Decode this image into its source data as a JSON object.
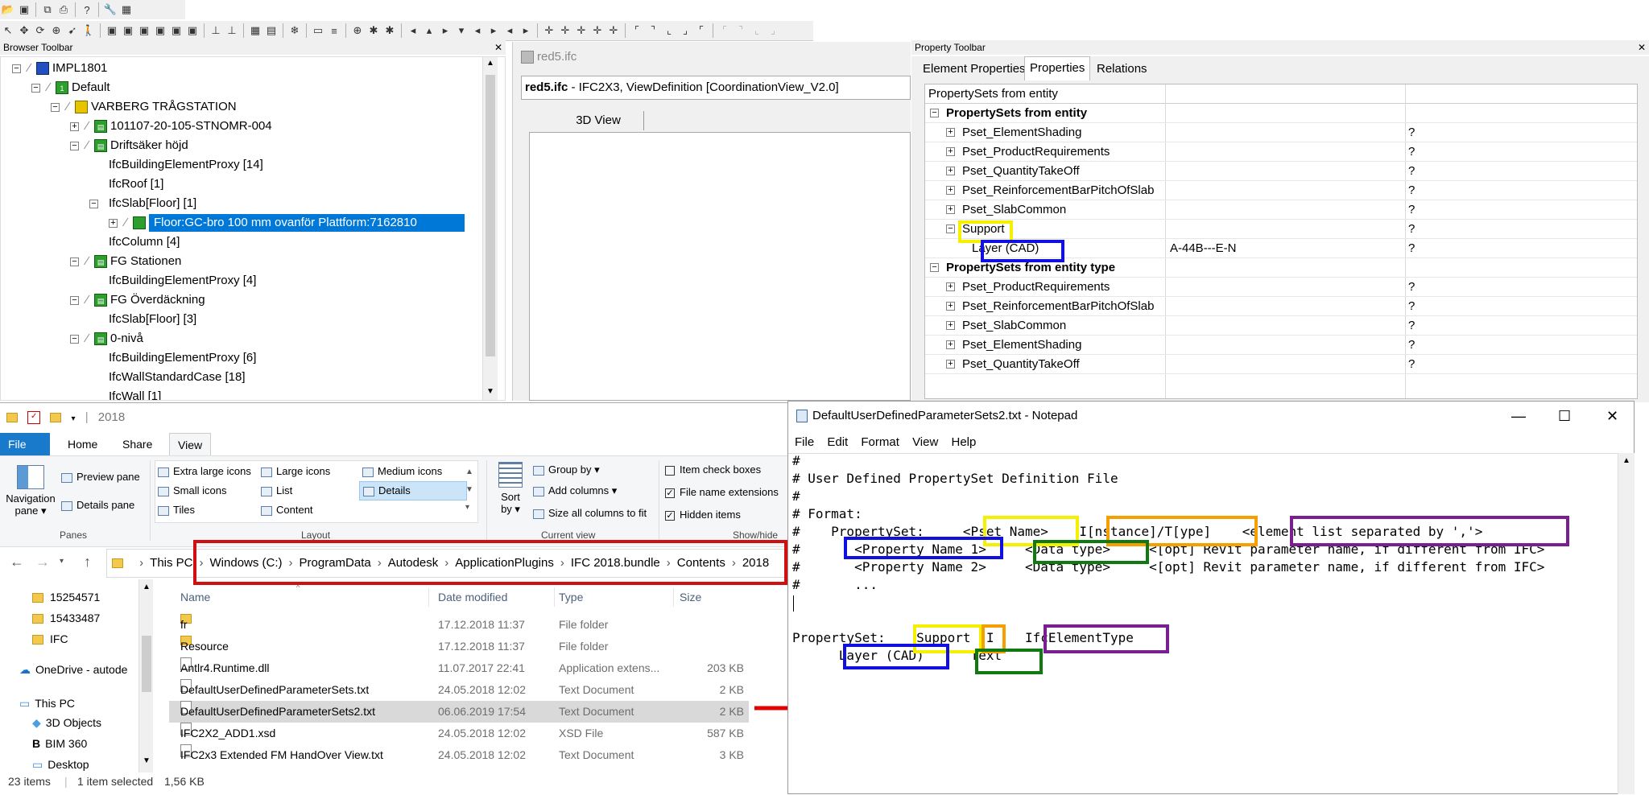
{
  "browser_toolbar": {
    "title": "Browser Toolbar",
    "tree": [
      {
        "label": "IMPL1801",
        "level": 0
      },
      {
        "label": "Default",
        "level": 1
      },
      {
        "label": "VARBERG TRÅGSTATION",
        "level": 2
      },
      {
        "label": "101107-20-105-STNOMR-004",
        "level": 3
      },
      {
        "label": "Driftsäker höjd",
        "level": 3
      },
      {
        "label": "IfcBuildingElementProxy [14]",
        "level": 4
      },
      {
        "label": "IfcRoof [1]",
        "level": 4
      },
      {
        "label": "IfcSlab[Floor] [1]",
        "level": 4
      },
      {
        "label": "Floor:GC-bro 100 mm ovanför Plattform:7162810",
        "level": 5
      },
      {
        "label": "IfcColumn [4]",
        "level": 4
      },
      {
        "label": "FG Stationen",
        "level": 3
      },
      {
        "label": "IfcBuildingElementProxy [4]",
        "level": 4
      },
      {
        "label": "FG Överdäckning",
        "level": 3
      },
      {
        "label": "IfcSlab[Floor] [3]",
        "level": 4
      },
      {
        "label": "0-nivå",
        "level": 3
      },
      {
        "label": "IfcBuildingElementProxy [6]",
        "level": 4
      },
      {
        "label": "IfcWallStandardCase [18]",
        "level": 4
      },
      {
        "label": "IfcWall [1]",
        "level": 4
      }
    ]
  },
  "viewer": {
    "tab_title": "red5.ifc",
    "header_file": "red5.ifc",
    "header_rest": " - IFC2X3, ViewDefinition [CoordinationView_V2.0]",
    "view_tab": "3D View"
  },
  "property_toolbar": {
    "title": "Property Toolbar",
    "tabs": [
      "Element Properties",
      "Properties",
      "Relations"
    ],
    "column_header": "PropertySets from entity",
    "rows": [
      {
        "name": "PropertySets from entity",
        "value": "",
        "flag": "",
        "bold": true,
        "indent": 0
      },
      {
        "name": "Pset_ElementShading",
        "value": "",
        "flag": "?",
        "indent": 1
      },
      {
        "name": "Pset_ProductRequirements",
        "value": "",
        "flag": "?",
        "indent": 1
      },
      {
        "name": "Pset_QuantityTakeOff",
        "value": "",
        "flag": "?",
        "indent": 1
      },
      {
        "name": "Pset_ReinforcementBarPitchOfSlab",
        "value": "",
        "flag": "?",
        "indent": 1
      },
      {
        "name": "Pset_SlabCommon",
        "value": "",
        "flag": "?",
        "indent": 1
      },
      {
        "name": "Support",
        "value": "",
        "flag": "?",
        "indent": 1
      },
      {
        "name": "Layer (CAD)",
        "value": "A-44B---E-N",
        "flag": "?",
        "indent": 2
      },
      {
        "name": "PropertySets from entity type",
        "value": "",
        "flag": "",
        "bold": true,
        "indent": 0
      },
      {
        "name": "Pset_ProductRequirements",
        "value": "",
        "flag": "?",
        "indent": 1
      },
      {
        "name": "Pset_ReinforcementBarPitchOfSlab",
        "value": "",
        "flag": "?",
        "indent": 1
      },
      {
        "name": "Pset_SlabCommon",
        "value": "",
        "flag": "?",
        "indent": 1
      },
      {
        "name": "Pset_ElementShading",
        "value": "",
        "flag": "?",
        "indent": 1
      },
      {
        "name": "Pset_QuantityTakeOff",
        "value": "",
        "flag": "?",
        "indent": 1
      }
    ]
  },
  "explorer": {
    "title": "2018",
    "ribbon_tabs": [
      "File",
      "Home",
      "Share",
      "View"
    ],
    "panes": {
      "navigation": "Navigation",
      "navigation2": "pane",
      "preview": "Preview pane",
      "details": "Details pane",
      "label": "Panes"
    },
    "layout": {
      "items": [
        "Extra large icons",
        "Large icons",
        "Medium icons",
        "Small icons",
        "List",
        "Details",
        "Tiles",
        "Content"
      ],
      "label": "Layout"
    },
    "current_view": {
      "sort": "Sort",
      "sort2": "by",
      "group_by": "Group by",
      "add_columns": "Add columns",
      "size_all": "Size all columns to fit",
      "label": "Current view"
    },
    "show_hide": {
      "item_check": "Item check boxes",
      "extensions": "File name extensions",
      "hidden": "Hidden items",
      "label": "Show/hide"
    },
    "breadcrumb": [
      "This PC",
      "Windows (C:)",
      "ProgramData",
      "Autodesk",
      "ApplicationPlugins",
      "IFC 2018.bundle",
      "Contents",
      "2018"
    ],
    "nav": [
      "15254571",
      "15433487",
      "IFC",
      "OneDrive - autode",
      "This PC",
      "3D Objects",
      "BIM 360",
      "Desktop"
    ],
    "columns": [
      "Name",
      "Date modified",
      "Type",
      "Size"
    ],
    "files": [
      {
        "name": "fr",
        "date": "17.12.2018 11:37",
        "type": "File folder",
        "size": "",
        "kind": "folder"
      },
      {
        "name": "Resource",
        "date": "17.12.2018 11:37",
        "type": "File folder",
        "size": "",
        "kind": "folder"
      },
      {
        "name": "Antlr4.Runtime.dll",
        "date": "11.07.2017 22:41",
        "type": "Application extens...",
        "size": "203 KB",
        "kind": "doc"
      },
      {
        "name": "DefaultUserDefinedParameterSets.txt",
        "date": "24.05.2018 12:02",
        "type": "Text Document",
        "size": "2 KB",
        "kind": "doc"
      },
      {
        "name": "DefaultUserDefinedParameterSets2.txt",
        "date": "06.06.2019 17:54",
        "type": "Text Document",
        "size": "2 KB",
        "kind": "doc"
      },
      {
        "name": "IFC2X2_ADD1.xsd",
        "date": "24.05.2018 12:02",
        "type": "XSD File",
        "size": "587 KB",
        "kind": "doc"
      },
      {
        "name": "IFC2x3 Extended FM HandOver View.txt",
        "date": "24.05.2018 12:02",
        "type": "Text Document",
        "size": "3 KB",
        "kind": "doc"
      }
    ],
    "status": {
      "count": "23 items",
      "selected": "1 item selected",
      "size": "1,56 KB"
    }
  },
  "notepad": {
    "title": "DefaultUserDefinedParameterSets2.txt - Notepad",
    "menu": [
      "File",
      "Edit",
      "Format",
      "View",
      "Help"
    ],
    "lines": [
      "#",
      "# User Defined PropertySet Definition File",
      "#",
      "# Format:",
      "#    PropertySet:     <Pset Name>    I[nstance]/T[ype]    <element list separated by ','>",
      "#       <Property Name 1>     <Data type>     <[opt] Revit parameter name, if different from IFC>",
      "#       <Property Name 2>     <Data type>     <[opt] Revit parameter name, if different from IFC>",
      "#       ...",
      "",
      "",
      "PropertySet:    Support  I    IfcElementType",
      "      Layer (CAD)      Text"
    ]
  },
  "colors": {
    "selection": "#0078d7",
    "yellow": "#f5f000",
    "orange": "#f5a000",
    "purple": "#7a1f8f",
    "blue": "#1010e0",
    "green": "#107a10",
    "red": "#d01010"
  }
}
